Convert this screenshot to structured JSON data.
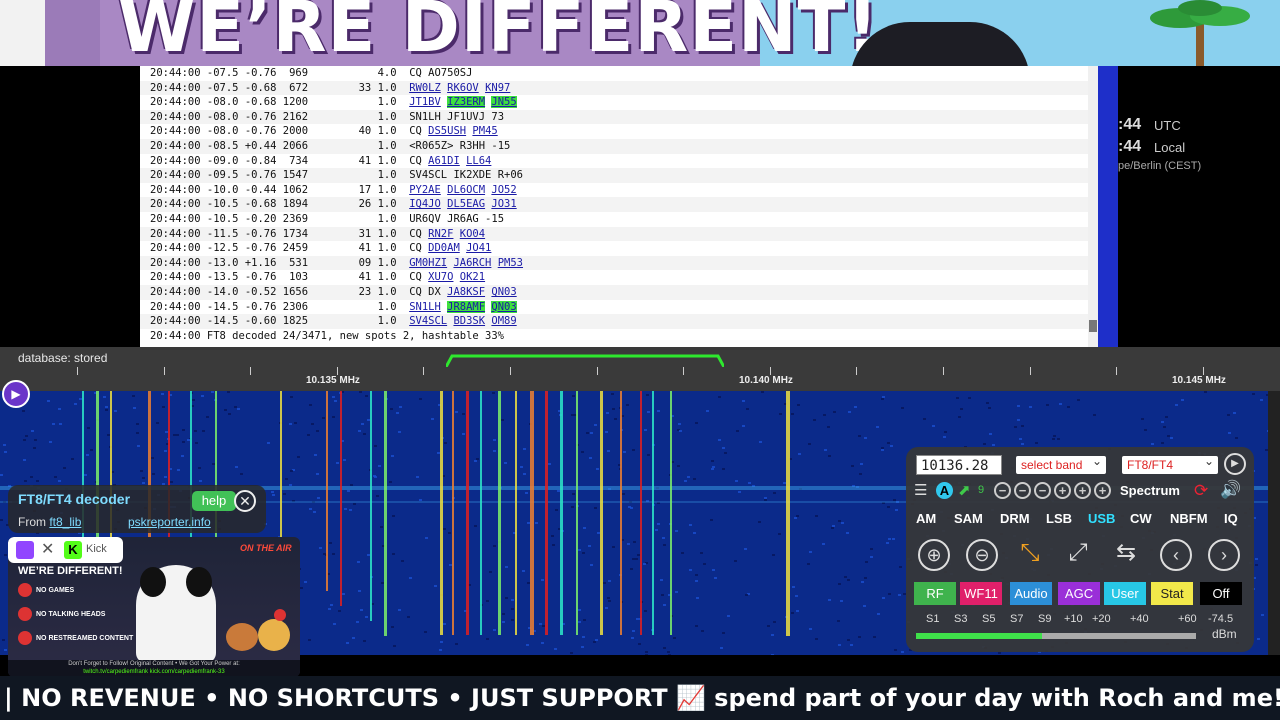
{
  "banner": {
    "title": "WE’RE DIFFERENT!"
  },
  "log": {
    "lines": [
      {
        "prefix": "20:44:00 -07.5 -0.76  969           4.0  ",
        "msg": [
          {
            "t": "CQ AO750SJ"
          }
        ]
      },
      {
        "prefix": "20:44:00 -07.5 -0.68  672        33 1.0  ",
        "msg": [
          {
            "t": "RW0LZ",
            "link": true
          },
          {
            "t": " "
          },
          {
            "t": "RK6OV",
            "link": true
          },
          {
            "t": " "
          },
          {
            "t": "KN97",
            "link": true
          }
        ]
      },
      {
        "prefix": "20:44:00 -08.0 -0.68 1200           1.0  ",
        "msg": [
          {
            "t": "JT1BV",
            "link": true
          },
          {
            "t": " "
          },
          {
            "t": "IZ3ERM",
            "link": true,
            "hl": true
          },
          {
            "t": " "
          },
          {
            "t": "JN55",
            "link": true,
            "hl": true
          }
        ]
      },
      {
        "prefix": "20:44:00 -08.0 -0.76 2162           1.0  ",
        "msg": [
          {
            "t": "SN1LH JF1UVJ 73"
          }
        ]
      },
      {
        "prefix": "20:44:00 -08.0 -0.76 2000        40 1.0  ",
        "msg": [
          {
            "t": "CQ "
          },
          {
            "t": "DS5USH",
            "link": true
          },
          {
            "t": " "
          },
          {
            "t": "PM45",
            "link": true
          }
        ]
      },
      {
        "prefix": "20:44:00 -08.5 +0.44 2066           1.0  ",
        "msg": [
          {
            "t": "<R065Z> R3HH -15"
          }
        ]
      },
      {
        "prefix": "20:44:00 -09.0 -0.84  734        41 1.0  ",
        "msg": [
          {
            "t": "CQ "
          },
          {
            "t": "A61DI",
            "link": true
          },
          {
            "t": " "
          },
          {
            "t": "LL64",
            "link": true
          }
        ]
      },
      {
        "prefix": "20:44:00 -09.5 -0.76 1547           1.0  ",
        "msg": [
          {
            "t": "SV4SCL IK2XDE R+06"
          }
        ]
      },
      {
        "prefix": "20:44:00 -10.0 -0.44 1062        17 1.0  ",
        "msg": [
          {
            "t": "PY2AE",
            "link": true
          },
          {
            "t": " "
          },
          {
            "t": "DL6OCM",
            "link": true
          },
          {
            "t": " "
          },
          {
            "t": "JO52",
            "link": true
          }
        ]
      },
      {
        "prefix": "20:44:00 -10.5 -0.68 1894        26 1.0  ",
        "msg": [
          {
            "t": "IQ4JO",
            "link": true
          },
          {
            "t": " "
          },
          {
            "t": "DL5EAG",
            "link": true
          },
          {
            "t": " "
          },
          {
            "t": "JO31",
            "link": true
          }
        ]
      },
      {
        "prefix": "20:44:00 -10.5 -0.20 2369           1.0  ",
        "msg": [
          {
            "t": "UR6QV JR6AG -15"
          }
        ]
      },
      {
        "prefix": "20:44:00 -11.5 -0.76 1734        31 1.0  ",
        "msg": [
          {
            "t": "CQ "
          },
          {
            "t": "RN2F",
            "link": true
          },
          {
            "t": " "
          },
          {
            "t": "KO04",
            "link": true
          }
        ]
      },
      {
        "prefix": "20:44:00 -12.5 -0.76 2459        41 1.0  ",
        "msg": [
          {
            "t": "CQ "
          },
          {
            "t": "DD0AM",
            "link": true
          },
          {
            "t": " "
          },
          {
            "t": "JO41",
            "link": true
          }
        ]
      },
      {
        "prefix": "20:44:00 -13.0 +1.16  531        09 1.0  ",
        "msg": [
          {
            "t": "GM0HZI",
            "link": true
          },
          {
            "t": " "
          },
          {
            "t": "JA6RCH",
            "link": true
          },
          {
            "t": " "
          },
          {
            "t": "PM53",
            "link": true
          }
        ]
      },
      {
        "prefix": "20:44:00 -13.5 -0.76  103        41 1.0  ",
        "msg": [
          {
            "t": "CQ "
          },
          {
            "t": "XU7O",
            "link": true
          },
          {
            "t": " "
          },
          {
            "t": "OK21",
            "link": true
          }
        ]
      },
      {
        "prefix": "20:44:00 -14.0 -0.52 1656        23 1.0  ",
        "msg": [
          {
            "t": "CQ DX "
          },
          {
            "t": "JA8KSF",
            "link": true
          },
          {
            "t": " "
          },
          {
            "t": "QN03",
            "link": true
          }
        ]
      },
      {
        "prefix": "20:44:00 -14.5 -0.76 2306           1.0  ",
        "msg": [
          {
            "t": "SN1LH",
            "link": true
          },
          {
            "t": " "
          },
          {
            "t": "JR8AMF",
            "link": true,
            "hl": true
          },
          {
            "t": " "
          },
          {
            "t": "QN03",
            "link": true,
            "hl": true
          }
        ]
      },
      {
        "prefix": "20:44:00 -14.5 -0.60 1825           1.0  ",
        "msg": [
          {
            "t": "SV4SCL",
            "link": true
          },
          {
            "t": " "
          },
          {
            "t": "BD3SK",
            "link": true
          },
          {
            "t": " "
          },
          {
            "t": "OM89",
            "link": true
          }
        ]
      },
      {
        "prefix": "20:44:00 FT8 decoded 24/3471, new spots 2, hashtable 33%",
        "msg": []
      }
    ]
  },
  "clock": {
    "utc_time": ":44",
    "utc_label": "UTC",
    "local_time": ":44",
    "local_label": "Local",
    "timezone": "pe/Berlin (CEST)"
  },
  "scale": {
    "database_status": "database: stored",
    "labels": [
      {
        "text": "10.135 MHz",
        "center": 336
      },
      {
        "text": "10.140 MHz",
        "center": 769
      },
      {
        "text": "10.145 MHz",
        "center": 1202
      }
    ]
  },
  "extension": {
    "title": "FT8/FT4 decoder",
    "help": "help",
    "from_label": "From",
    "from_link": "ft8_lib",
    "pskreporter": "pskreporter.info"
  },
  "overlay_card": {
    "platform_kick": "Kick",
    "on_air": "ON THE AIR",
    "heading": "WE’RE DIFFERENT!",
    "items": [
      "NO GAMES",
      "NO TALKING HEADS",
      "NO RESTREAMED CONTENT"
    ],
    "footer": "Don't Forget to Follow! Original Content • We Got Your Power at:",
    "footer_links": "twitch.tv/carpediemfrank  kick.com/carpediemfrank-33"
  },
  "control": {
    "frequency": "10136.28",
    "band_select": "select band",
    "ext_select": "FT8/FT4",
    "agc_a": "A",
    "nine": "9",
    "spectrum": "Spectrum",
    "modes": [
      "AM",
      "SAM",
      "DRM",
      "LSB",
      "USB",
      "CW",
      "NBFM",
      "IQ"
    ],
    "active_mode": "USB",
    "tabs": [
      {
        "label": "RF",
        "bg": "#3fb34d"
      },
      {
        "label": "WF11",
        "bg": "#e0206a"
      },
      {
        "label": "Audio",
        "bg": "#2c8fd8"
      },
      {
        "label": "AGC",
        "bg": "#9a2fd8"
      },
      {
        "label": "User",
        "bg": "#27c7e6"
      },
      {
        "label": "Stat",
        "bg": "#f2e84a"
      },
      {
        "label": "Off",
        "bg": "#000000"
      }
    ],
    "smeter": {
      "scale": [
        "S1",
        "S3",
        "S5",
        "S7",
        "S9",
        "+10",
        "+20",
        "+40",
        "+60"
      ],
      "reading": "-74.5",
      "unit": "dBm"
    }
  },
  "ticker": {
    "text": "| NO REVENUE • NO SHORTCUTS • JUST SUPPORT 📈 spend part of your day with Roch and me!"
  }
}
